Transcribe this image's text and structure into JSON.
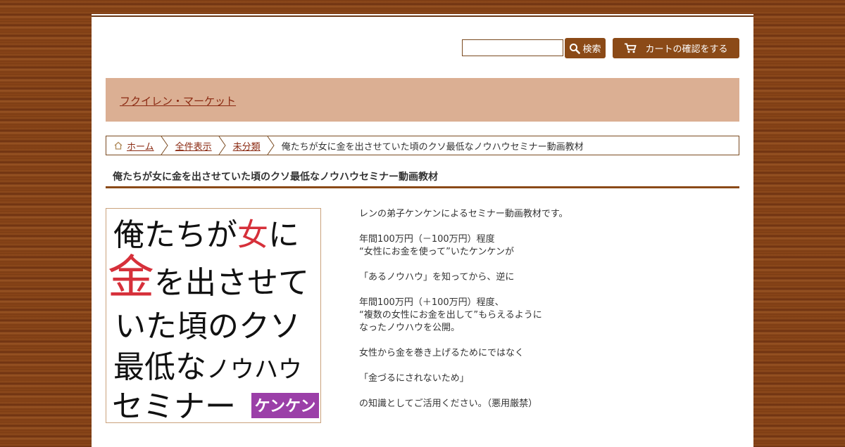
{
  "header": {
    "search_placeholder": "",
    "search_label": "検索",
    "cart_label": "カートの確認をする"
  },
  "shop": {
    "name": "フクイレン・マーケット"
  },
  "breadcrumb": {
    "home": "ホーム",
    "all": "全件表示",
    "category": "未分類",
    "current": "俺たちが女に金を出させていた頃のクソ最低なノウハウセミナー動画教材"
  },
  "product": {
    "title": "俺たちが女に金を出させていた頃のクソ最低なノウハウセミナー動画教材",
    "image_text": {
      "line1a": "俺たちが",
      "line1b": "女",
      "line1c": "に",
      "line2a": "金",
      "line2b": "を出させて",
      "line3": "いた頃のクソ",
      "line4a": "最低な",
      "line4b": "ノウハウ",
      "line5": "セミナー",
      "badge": "ケンケン"
    },
    "description": [
      "レンの弟子ケンケンによるセミナー動画教材です。",
      "",
      "年間100万円（－100万円）程度",
      "“女性にお金を使って”いたケンケンが",
      "",
      "「あるノウハウ」を知ってから、逆に",
      "",
      "年間100万円（＋100万円）程度、",
      "“複数の女性にお金を出して”もらえるように",
      "なったノウハウを公開。",
      "",
      "女性から金を巻き上げるためにではなく",
      "",
      "「金づるにされないため」",
      "",
      "の知識としてご活用ください。（悪用厳禁）"
    ]
  },
  "colors": {
    "accent": "#8b4a17",
    "banner": "#dbaf93",
    "link": "#8b2a12",
    "red_text": "#d6303a",
    "badge": "#9b3fa8"
  }
}
